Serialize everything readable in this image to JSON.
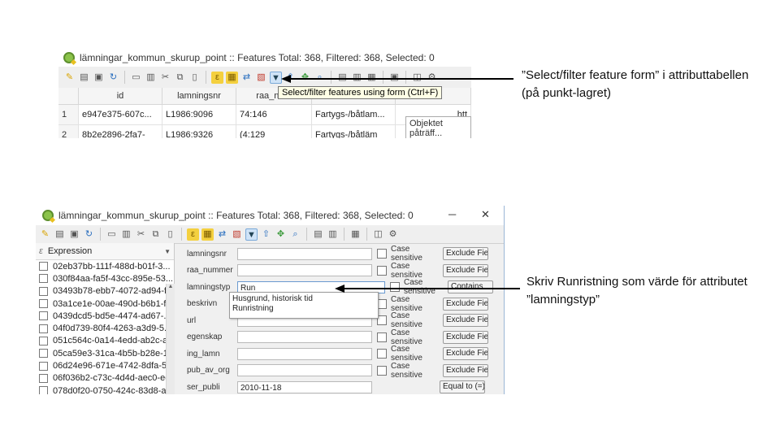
{
  "screenshot1": {
    "window_title": "lämningar_kommun_skurup_point :: Features Total: 368, Filtered: 368, Selected: 0",
    "tooltip": "Select/filter features using form (Ctrl+F)",
    "table": {
      "columns": [
        "",
        "id",
        "lamningsnr",
        "raa_num",
        "",
        ""
      ],
      "rows": [
        [
          "1",
          "e947e375-607c...",
          "L1986:9096",
          "74:146",
          "Fartygs-/båtlam...",
          "htt"
        ],
        [
          "2",
          "8b2e2896-2fa7-",
          "L1986:9326",
          "(4:129",
          "Fartygs-/båtläm",
          "htt"
        ]
      ],
      "cell_popup": "Objektet påträff..."
    }
  },
  "screenshot2": {
    "window_title": "lämningar_kommun_skurup_point :: Features Total: 368, Filtered: 368, Selected: 0",
    "window_buttons": {
      "minimize": "─",
      "maximize": "☐",
      "close": "✕"
    },
    "expression_header": "Expression",
    "expression_prefix": "ɛ",
    "ids": [
      "02eb37bb-111f-488d-b01f-3...",
      "030f84aa-fa5f-43cc-895e-53...",
      "03493b78-ebb7-4072-ad94-f...",
      "03a1ce1e-00ae-490d-b6b1-f...",
      "0439dcd5-bd5e-4474-ad67-...",
      "04f0d739-80f4-4263-a3d9-5...",
      "051c564c-0a14-4edd-ab2c-a...",
      "05ca59e3-31ca-4b5b-b28e-1...",
      "06d24e96-671e-4742-8dfa-5...",
      "06f036b2-c73c-4d4d-aec0-ee...",
      "078d0f20-0750-424c-83d8-af..."
    ],
    "form_rows": [
      {
        "label": "lamningsnr",
        "value": "",
        "case": "Case sensitive",
        "button": "Exclude Field"
      },
      {
        "label": "raa_nummer",
        "value": "",
        "case": "Case sensitive",
        "button": "Exclude Field"
      },
      {
        "label": "lamningstyp",
        "value": "Run",
        "case": "Case sensitive",
        "button": "Contains"
      },
      {
        "label": "beskrivn",
        "value": "",
        "case": "Case sensitive",
        "button": "Exclude Field"
      },
      {
        "label": "url",
        "value": "",
        "case": "Case sensitive",
        "button": "Exclude Field"
      },
      {
        "label": "egenskap",
        "value": "",
        "case": "Case sensitive",
        "button": "Exclude Field"
      },
      {
        "label": "ing_lamn",
        "value": "",
        "case": "Case sensitive",
        "button": "Exclude Field"
      },
      {
        "label": "pub_av_org",
        "value": "",
        "case": "Case sensitive",
        "button": "Exclude Field"
      },
      {
        "label": "ser_publi",
        "value": "2010-11-18",
        "case": "",
        "button": "Equal to (=)"
      }
    ],
    "dropdown_options": [
      "Husgrund, historisk tid",
      "Runristning"
    ]
  },
  "annotations": {
    "note1": "”Select/filter feature form” i attributtabellen (på punkt-lagret)",
    "note2": "Skriv Runristning som värde för attributet ”lamningstyp”"
  }
}
